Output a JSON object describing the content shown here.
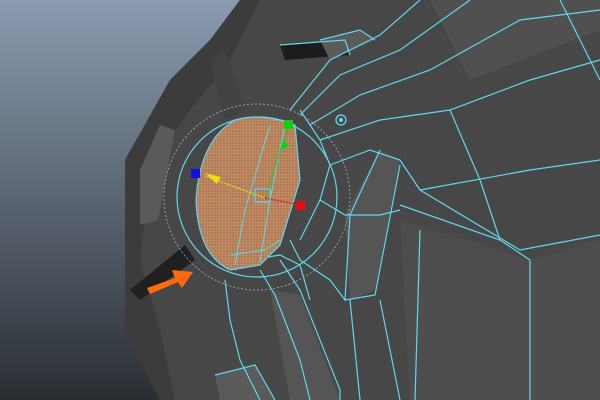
{
  "viewport": {
    "colors": {
      "background_top": "#8a9bb0",
      "background_bottom": "#2e3236",
      "mesh": "#4a4a4a",
      "wireframe": "#5fd8f0",
      "selection": "#c8875a",
      "arrow": "#ff6a10",
      "axis_x": "#e01010",
      "axis_y": "#10d010",
      "axis_z": "#1010e0",
      "axis_free": "#e8e010"
    },
    "icons": [
      "move-manipulator-icon",
      "rotate-manipulator-icon",
      "pivot-point-icon",
      "pointer-arrow-icon"
    ]
  }
}
